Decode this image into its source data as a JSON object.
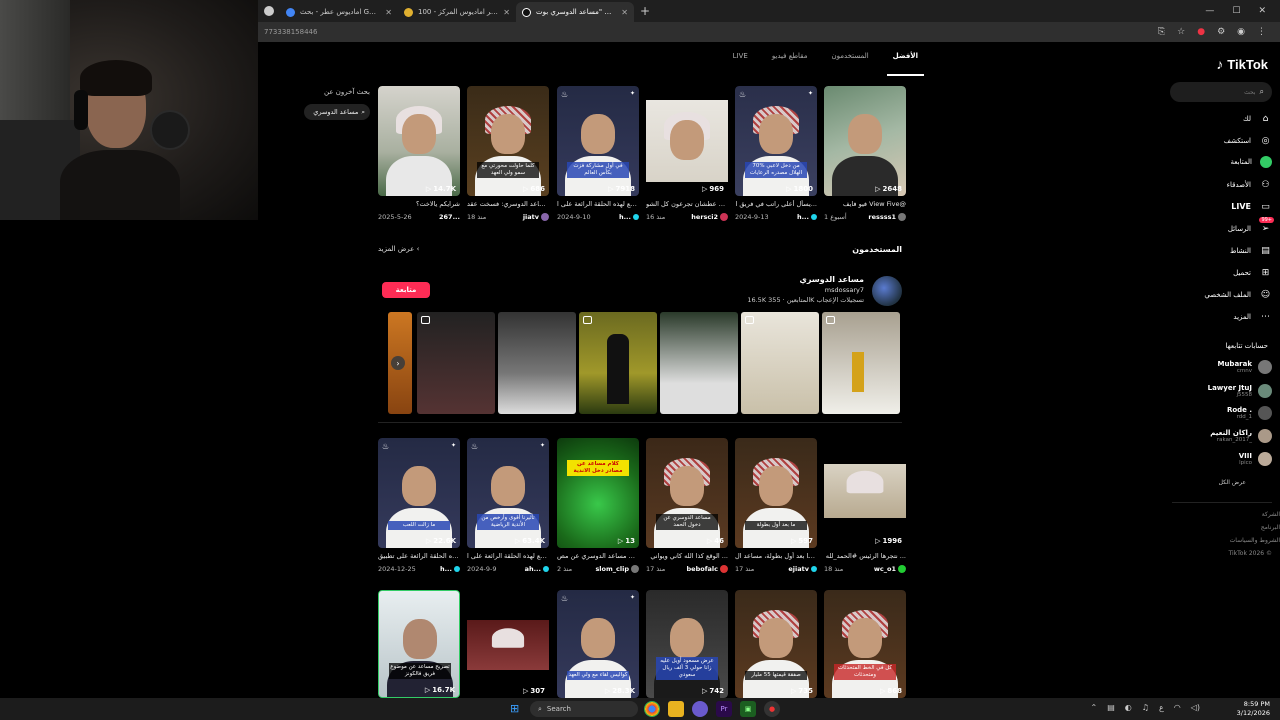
{
  "browser": {
    "tabs": [
      {
        "title": "اماديوس عطر - بحث Google",
        "active": false
      },
      {
        "title": "اشتري عطر اماديوس المركز - 100",
        "active": false
      },
      {
        "title": "اعثر على \"مساعد الدوسري بوت\"",
        "active": true
      }
    ],
    "url": "773338158446",
    "new_tab": "+"
  },
  "tiktok": {
    "logo": "TikTok",
    "search_placeholder": "بحث",
    "nav": [
      {
        "label": "لك",
        "icon": "home-icon"
      },
      {
        "label": "استكشف",
        "icon": "compass-icon"
      },
      {
        "label": "المتابعة",
        "icon": "following-icon"
      },
      {
        "label": "الأصدقاء",
        "icon": "friends-icon"
      },
      {
        "label": "LIVE",
        "icon": "live-icon"
      },
      {
        "label": "الرسائل",
        "icon": "messages-icon",
        "badge": "99+"
      },
      {
        "label": "النشاط",
        "icon": "activity-icon"
      },
      {
        "label": "تحميل",
        "icon": "upload-icon"
      },
      {
        "label": "الملف الشخصي",
        "icon": "profile-icon"
      },
      {
        "label": "المزيد",
        "icon": "more-icon"
      }
    ],
    "following_title": "حسابات تتابعها",
    "following": [
      {
        "name": "Mubarak",
        "sub": "cmnv"
      },
      {
        "name": "Lawyer JtuJ",
        "sub": "j5558"
      },
      {
        "name": "Rode .",
        "sub": "rdd_1"
      },
      {
        "name": "راكان النعيم",
        "sub": "rakan_2017_"
      },
      {
        "name": "VIII",
        "sub": "lpico"
      }
    ],
    "see_all": "عرض الكل",
    "footer": [
      "الشركة",
      "البرنامج",
      "الشروط والسياسات",
      "TikTok 2026 ©"
    ],
    "tabs": [
      {
        "label": "الأفضل",
        "active": true
      },
      {
        "label": "المستخدمون",
        "active": false
      },
      {
        "label": "مقاطع فيديو",
        "active": false
      },
      {
        "label": "LIVE",
        "active": false
      }
    ],
    "also_search": {
      "title": "بحث آخرون عن",
      "chip": "مساعد الدوسري"
    },
    "row1": [
      {
        "views": "2648",
        "desc": "فيو فايف View Five@",
        "author": "ressss1",
        "time": "أسبوع 1",
        "caption": ""
      },
      {
        "views": "1800",
        "desc": "يسأل أعلى راتب في فريق ا...",
        "author": "h...",
        "time": "2024-9-13",
        "caption": "70% من دخل لاعبي الهلال مصدره الرعايات"
      },
      {
        "views": "969",
        "desc": "غرلو عطشان تجرعون كل الشو...",
        "author": "hersci2",
        "time": "منذ 16",
        "caption": ""
      },
      {
        "views": "7918",
        "desc": "استمع لهذه الحلقة الرائعة على ا...",
        "author": "h...",
        "time": "2024-9-10",
        "caption": "في أول مشاركة فزت بكأس العالم"
      },
      {
        "views": "686",
        "desc": "مساعد الدوسري: فسخت عقد ...",
        "author": "jiatv",
        "time": "منذ 18",
        "caption": "كلما حاولت محورتي مع سمو ولي العهد"
      },
      {
        "views": "14.7K",
        "desc": "شرايكم يالاخت؟",
        "author": "267...",
        "time": "2025-5-26",
        "caption": ""
      }
    ],
    "users_title": "المستخدمون",
    "users_more": "عرض المزيد",
    "user": {
      "name": "مساعد الدوسري",
      "handle": "msdossary7",
      "followers": "16.5K",
      "followers_label": "المتابعين",
      "likes": "355K",
      "likes_label": "تسجيلات الإعجاب",
      "follow": "متابعة"
    },
    "row2": [
      {
        "views": "1996",
        "desc": "نتجرها الرئيس #الحمد_لله ...",
        "author": "wc_o1",
        "time": "منذ 18",
        "caption": ""
      },
      {
        "views": "597",
        "desc": "ما بعد أول بطولة، مساعد ال...",
        "author": "ejiatv",
        "time": "منذ 17",
        "caption": "ما بعد أول بطولة"
      },
      {
        "views": "46",
        "desc": "الوقع كذا الله كاني ويواني ...",
        "author": "bebofalc",
        "time": "منذ 17",
        "caption": "مساعد الدوسري عن دخول الحمد"
      },
      {
        "views": "13",
        "desc": "كلام مساعد الدوسري عن مص...",
        "author": "slom_clip",
        "time": "منذ 2",
        "caption": "كلام مساعد عن مصادر دخل الاندية"
      },
      {
        "views": "63.4K",
        "desc": "استمع لهذه الحلقة الرائعة على ا...",
        "author": "ah...",
        "time": "2024-9-9",
        "caption": "تأثيرنا أقوى وأرخص من الأندية الرياضية"
      },
      {
        "views": "22.6K",
        "desc": "استمع لهذه الحلقة الرائعة على تطبيق...",
        "author": "h...",
        "time": "2024-12-25",
        "caption": "ما زالت اللعب"
      }
    ],
    "row3": [
      {
        "views": "868",
        "caption": "كل في الخط المتحدثات ومتحدثات"
      },
      {
        "views": "735",
        "caption": "صفقة قيمتها 55 مليار"
      },
      {
        "views": "742",
        "caption": "عرض مسعود أويل عليه زانا حولي 3 آلف ريال سعودي"
      },
      {
        "views": "28.3K",
        "caption": "كواليس لقاء مع ولي العهد"
      },
      {
        "views": "307",
        "caption": ""
      },
      {
        "views": "16.7K",
        "caption": "تصريح مساعد عن موضوع فريق فالكونز"
      }
    ]
  },
  "taskbar": {
    "search": "Search",
    "time": "8:59 PM",
    "date": "3/12/2026",
    "lang": "ع"
  }
}
